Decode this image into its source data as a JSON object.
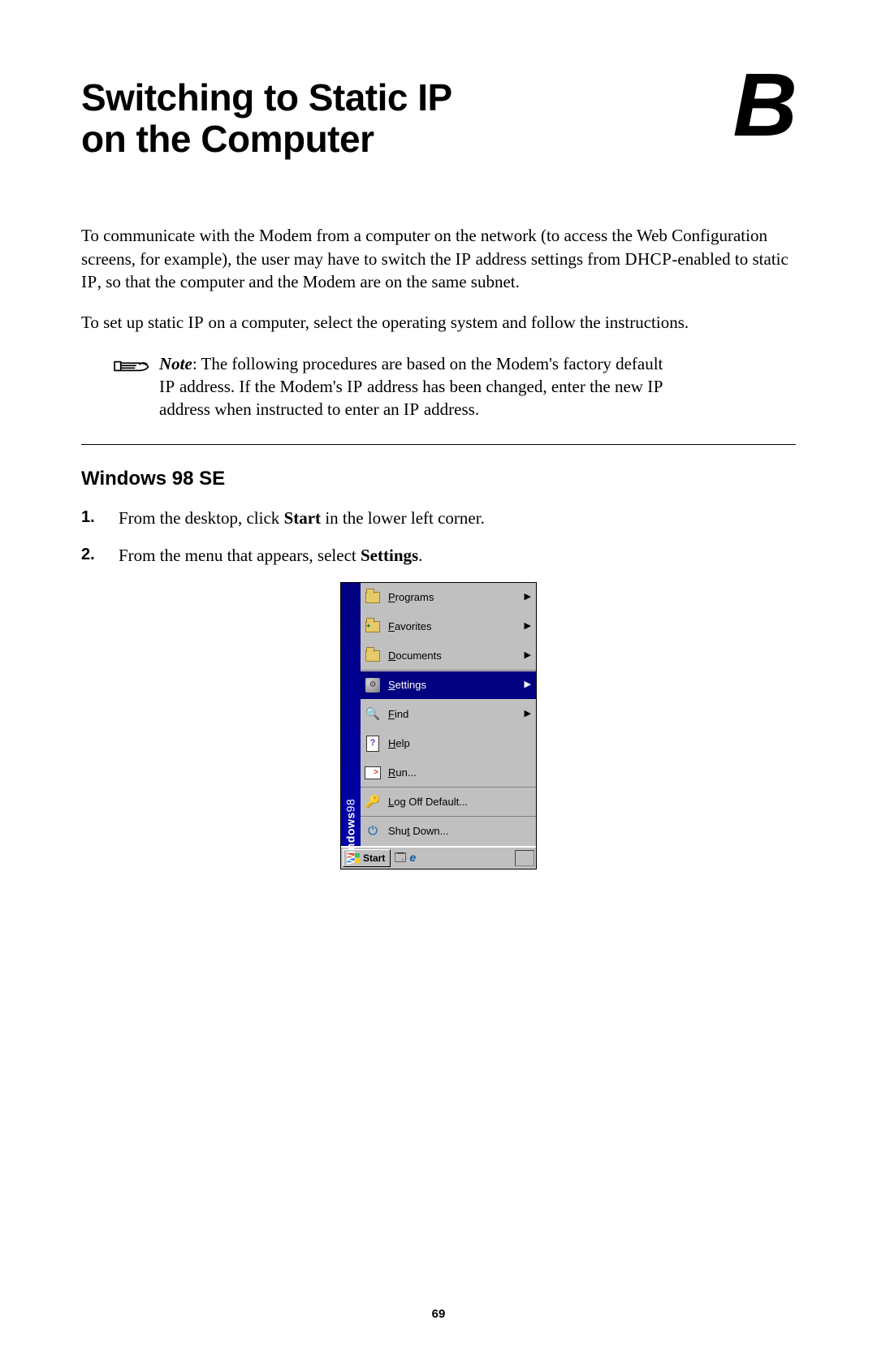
{
  "header": {
    "title_line1": "Switching to Static IP",
    "title_line2": "on the Computer",
    "appendix_letter": "B"
  },
  "intro": {
    "p1_a": "To communicate with the Modem from a computer on the network (to access the Web Configuration screens, for example), the user may have to switch the ",
    "p1_b": " address settings from ",
    "p1_c": "-enabled to static ",
    "p1_d": ", so that the computer and the Modem are on the same subnet.",
    "p2_a": "To set up static ",
    "p2_b": " on a computer, select the operating system and follow the instructions.",
    "sc_ip": "IP",
    "sc_dhcp": "DHCP"
  },
  "note": {
    "label": "Note",
    "t1": ": The following procedures are based on the Modem's factory default ",
    "t2": " address. If the Modem's ",
    "t3": " address has been changed, enter the new ",
    "t4": " address when instructed to enter an ",
    "t5": " address.",
    "sc_ip": "IP"
  },
  "section": {
    "heading": "Windows 98 SE",
    "step1_a": "From the desktop, click ",
    "step1_bold": "Start",
    "step1_b": " in the lower left corner.",
    "step2_a": "From the menu that appears, select ",
    "step2_bold": "Settings",
    "step2_b": ".",
    "num1": "1.",
    "num2": "2."
  },
  "startmenu": {
    "side_brand": "Windows",
    "side_ver": "98",
    "items": [
      {
        "acc": "P",
        "rest": "rograms",
        "arrow": true,
        "selected": false,
        "icon": "programs"
      },
      {
        "acc": "F",
        "rest": "avorites",
        "arrow": true,
        "selected": false,
        "icon": "favorites"
      },
      {
        "acc": "D",
        "rest": "ocuments",
        "arrow": true,
        "selected": false,
        "icon": "documents",
        "sep_below": true
      },
      {
        "acc": "S",
        "rest": "ettings",
        "arrow": true,
        "selected": true,
        "icon": "settings"
      },
      {
        "acc": "F",
        "rest": "ind",
        "arrow": true,
        "selected": false,
        "icon": "find"
      },
      {
        "acc": "H",
        "rest": "elp",
        "arrow": false,
        "selected": false,
        "icon": "help"
      },
      {
        "acc": "R",
        "rest": "un...",
        "arrow": false,
        "selected": false,
        "icon": "run",
        "sep_below": true
      },
      {
        "acc": "L",
        "rest": "og Off Default...",
        "arrow": false,
        "selected": false,
        "icon": "logoff",
        "sep_below": true
      },
      {
        "acc": "",
        "rest": "Shu",
        "acc2": "t",
        "rest2": " Down...",
        "arrow": false,
        "selected": false,
        "icon": "shutdown",
        "underline_mid": true
      }
    ],
    "taskbar": {
      "start": "Start"
    },
    "arrow_glyph": "▶"
  },
  "page_number": "69"
}
